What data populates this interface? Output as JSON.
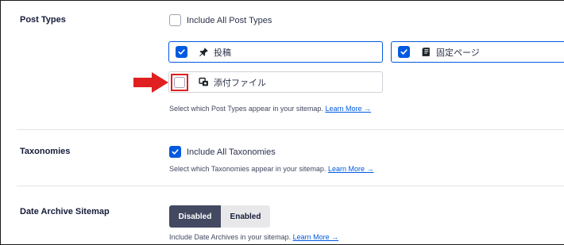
{
  "post_types": {
    "label": "Post Types",
    "include_all_label": "Include All Post Types",
    "include_all_checked": false,
    "items": [
      {
        "label": "投稿",
        "icon": "pin-icon",
        "checked": true
      },
      {
        "label": "固定ページ",
        "icon": "page-icon",
        "checked": true
      },
      {
        "label": "添付ファイル",
        "icon": "media-icon",
        "checked": false
      }
    ],
    "help_text": "Select which Post Types appear in your sitemap.",
    "help_link": "Learn More →"
  },
  "taxonomies": {
    "label": "Taxonomies",
    "include_all_label": "Include All Taxonomies",
    "include_all_checked": true,
    "help_text": "Select which Taxonomies appear in your sitemap.",
    "help_link": "Learn More →"
  },
  "date_archive": {
    "label": "Date Archive Sitemap",
    "options": [
      "Disabled",
      "Enabled"
    ],
    "selected": "Disabled",
    "help_text": "Include Date Archives in your sitemap.",
    "help_link": "Learn More →"
  },
  "colors": {
    "accent": "#005ae0",
    "highlight": "#e02020",
    "toggle_active": "#434960"
  }
}
